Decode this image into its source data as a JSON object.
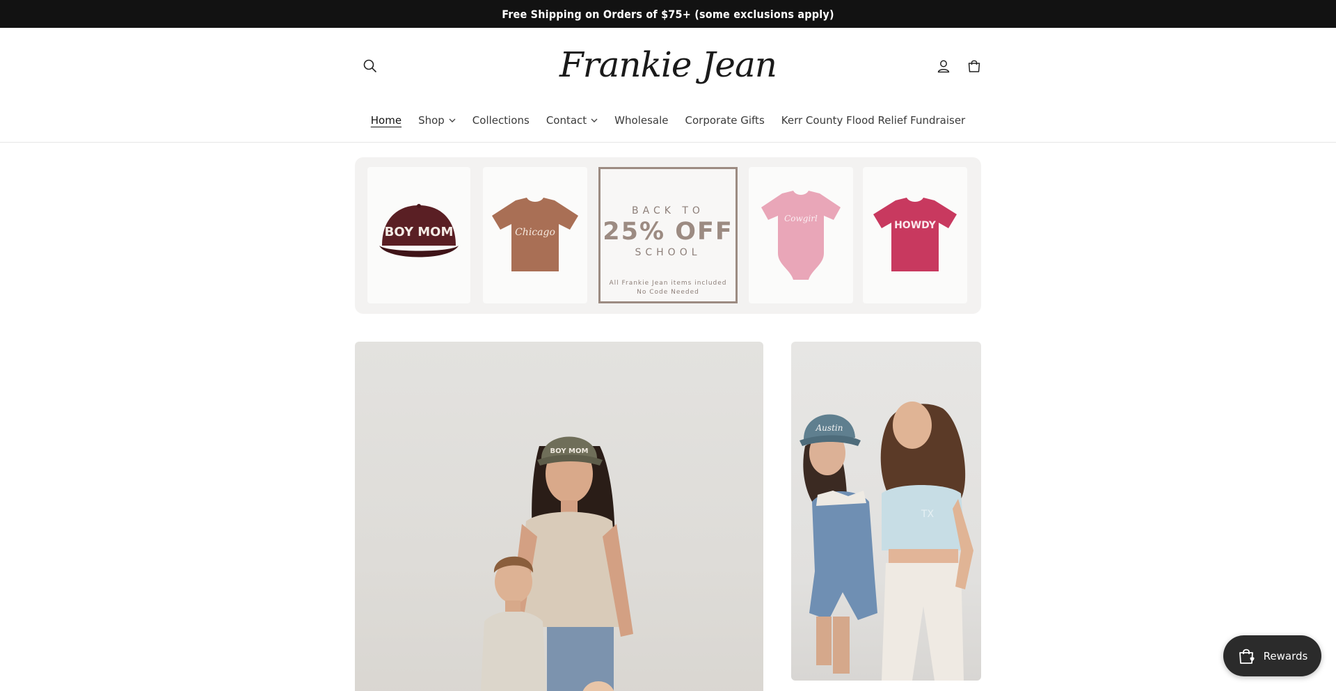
{
  "announcement": {
    "text": "Free Shipping on Orders of $75+ (some exclusions apply)"
  },
  "header": {
    "logo_text": "Frankie Jean",
    "icons": {
      "search": "search-icon",
      "account": "user-icon",
      "cart": "cart-icon"
    }
  },
  "nav": {
    "items": [
      {
        "label": "Home",
        "active": true,
        "dropdown": false
      },
      {
        "label": "Shop",
        "active": false,
        "dropdown": true
      },
      {
        "label": "Collections",
        "active": false,
        "dropdown": false
      },
      {
        "label": "Contact",
        "active": false,
        "dropdown": true
      },
      {
        "label": "Wholesale",
        "active": false,
        "dropdown": false
      },
      {
        "label": "Corporate Gifts",
        "active": false,
        "dropdown": false
      },
      {
        "label": "Kerr County Flood Relief Fundraiser",
        "active": false,
        "dropdown": false
      }
    ]
  },
  "banner": {
    "products": [
      {
        "item": "hat",
        "text": "BOY MOM",
        "color": "#5a1f24"
      },
      {
        "item": "tee",
        "text": "Chicago",
        "color": "#a96f55"
      },
      {
        "item": "onesie",
        "text": "Cowgirl",
        "color": "#e9a6b8"
      },
      {
        "item": "tee",
        "text": "HOWDY",
        "color": "#c8395f"
      }
    ],
    "promo": {
      "line1": "BACK TO",
      "big": "25% OFF",
      "line2": "SCHOOL",
      "fine1": "All Frankie Jean items included",
      "fine2": "No Code Needed"
    }
  },
  "photos": {
    "main": {
      "hat_text": "BOY MOM"
    },
    "side": {
      "hat_text": "Austin",
      "shirt_text": "TX"
    }
  },
  "rewards": {
    "label": "Rewards"
  },
  "colors": {
    "announcement_bg": "#121212",
    "rewards_bg": "#2b2b2b"
  }
}
